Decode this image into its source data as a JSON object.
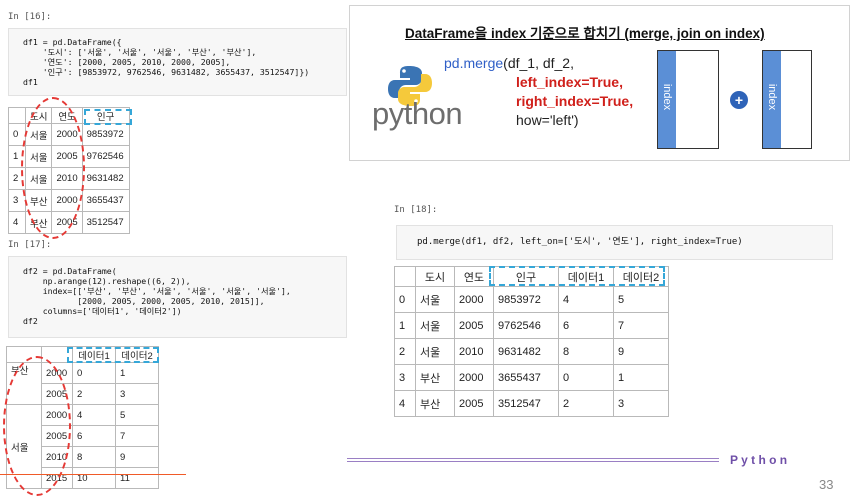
{
  "cell16": {
    "prompt": "In [16]:",
    "code": [
      "df1 = pd.DataFrame({",
      "    '도시': ['서울', '서울', '서울', '부산', '부산'],",
      "    '연도': [2000, 2005, 2010, 2000, 2005],",
      "    '인구': [9853972, 9762546, 9631482, 3655437, 3512547]})",
      "df1"
    ],
    "table": {
      "columns": [
        "",
        "도시",
        "연도",
        "인구"
      ],
      "rows": [
        [
          "0",
          "서울",
          "2000",
          "9853972"
        ],
        [
          "1",
          "서울",
          "2005",
          "9762546"
        ],
        [
          "2",
          "서울",
          "2010",
          "9631482"
        ],
        [
          "3",
          "부산",
          "2000",
          "3655437"
        ],
        [
          "4",
          "부산",
          "2005",
          "3512547"
        ]
      ]
    }
  },
  "cell17": {
    "prompt": "In [17]:",
    "code": [
      "df2 = pd.DataFrame(",
      "    np.arange(12).reshape((6, 2)),",
      "    index=[['부산', '부산', '서울', '서울', '서울', '서울'],",
      "           [2000, 2005, 2000, 2005, 2010, 2015]],",
      "    columns=['데이터1', '데이터2'])",
      "df2"
    ],
    "table": {
      "columns": [
        "데이터1",
        "데이터2"
      ],
      "level0": [
        "부산",
        "서울"
      ],
      "rows": [
        [
          "2000",
          "0",
          "1"
        ],
        [
          "2005",
          "2",
          "3"
        ],
        [
          "2000",
          "4",
          "5"
        ],
        [
          "2005",
          "6",
          "7"
        ],
        [
          "2010",
          "8",
          "9"
        ],
        [
          "2015",
          "10",
          "11"
        ]
      ]
    }
  },
  "cell18": {
    "prompt": "In [18]:",
    "code": "pd.merge(df1, df2, left_on=['도시', '연도'], right_index=True)",
    "table": {
      "columns": [
        "",
        "도시",
        "연도",
        "인구",
        "데이터1",
        "데이터2"
      ],
      "rows": [
        [
          "0",
          "서울",
          "2000",
          "9853972",
          "4",
          "5"
        ],
        [
          "1",
          "서울",
          "2005",
          "9762546",
          "6",
          "7"
        ],
        [
          "2",
          "서울",
          "2010",
          "9631482",
          "8",
          "9"
        ],
        [
          "3",
          "부산",
          "2000",
          "3655437",
          "0",
          "1"
        ],
        [
          "4",
          "부산",
          "2005",
          "3512547",
          "2",
          "3"
        ]
      ]
    }
  },
  "infobox": {
    "title": "DataFrame을 index 기준으로 합치기 (merge, join on index)",
    "logo_text": "python",
    "line1_fn": "pd.merge",
    "line1_args": "(df_1, df_2,",
    "line2": "left_index=True,",
    "line3": "right_index=True,",
    "line4": "how='left')",
    "index_label_left": "index",
    "index_label_right": "index",
    "plus": "+"
  },
  "footer": {
    "brand": "P y t h o n",
    "page_number": "33"
  },
  "colors": {
    "accent_red": "#e53935",
    "accent_cyan": "#35a7d8",
    "index_blue": "#5b8fd6",
    "fn_blue": "#2f5fc7"
  }
}
